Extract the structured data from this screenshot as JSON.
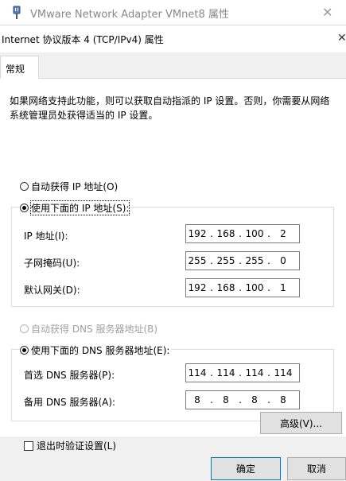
{
  "outer_window": {
    "title": "VMware Network Adapter VMnet8 属性",
    "close": "✕"
  },
  "dialog": {
    "title": "Internet 协议版本 4 (TCP/IPv4) 属性",
    "close": "✕",
    "tab": "常规",
    "description": "如果网络支持此功能，则可以获取自动指派的 IP 设置。否则，你需要从网络系统管理员处获得适当的 IP 设置。"
  },
  "ip_section": {
    "auto_option": "自动获得 IP 地址(O)",
    "manual_option": "使用下面的 IP 地址(S):",
    "selected": "manual",
    "fields": [
      {
        "label": "IP 地址(I):",
        "value": [
          "192",
          "168",
          "100",
          "2"
        ]
      },
      {
        "label": "子网掩码(U):",
        "value": [
          "255",
          "255",
          "255",
          "0"
        ]
      },
      {
        "label": "默认网关(D):",
        "value": [
          "192",
          "168",
          "100",
          "1"
        ]
      }
    ]
  },
  "dns_section": {
    "auto_option": "自动获得 DNS 服务器地址(B)",
    "manual_option": "使用下面的 DNS 服务器地址(E):",
    "selected": "manual",
    "fields": [
      {
        "label": "首选 DNS 服务器(P):",
        "value": [
          "114",
          "114",
          "114",
          "114"
        ]
      },
      {
        "label": "备用 DNS 服务器(A):",
        "value": [
          "8",
          "8",
          "8",
          "8"
        ]
      }
    ]
  },
  "validate_on_exit": {
    "label": "退出时验证设置(L)",
    "checked": false
  },
  "buttons": {
    "advanced": "高级(V)...",
    "ok": "确定",
    "cancel": "取消"
  },
  "colors": {
    "accent": "#0078d7",
    "disabled_text": "#a0a0a0"
  }
}
